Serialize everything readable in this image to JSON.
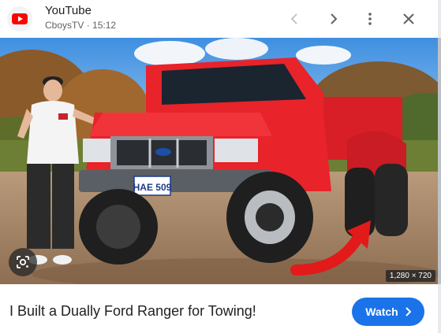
{
  "header": {
    "source_name": "YouTube",
    "channel": "CboysTV",
    "separator": "·",
    "duration": "15:12",
    "logo_icon": "youtube-logo-icon",
    "prev_icon": "chevron-left-icon",
    "next_icon": "chevron-right-icon",
    "more_icon": "more-vert-icon",
    "close_icon": "close-icon"
  },
  "image": {
    "dimensions": "1,280 × 720",
    "lens_icon": "google-lens-icon",
    "thumbnail_text": {
      "plate": "HAE 509"
    }
  },
  "caption": {
    "title": "I Built a Dually Ford Ranger for Towing!",
    "watch_label": "Watch",
    "watch_icon": "chevron-right-icon"
  },
  "colors": {
    "brand_red": "#ff0000",
    "accent_blue": "#1a73e8",
    "truck_red": "#e8232a"
  }
}
